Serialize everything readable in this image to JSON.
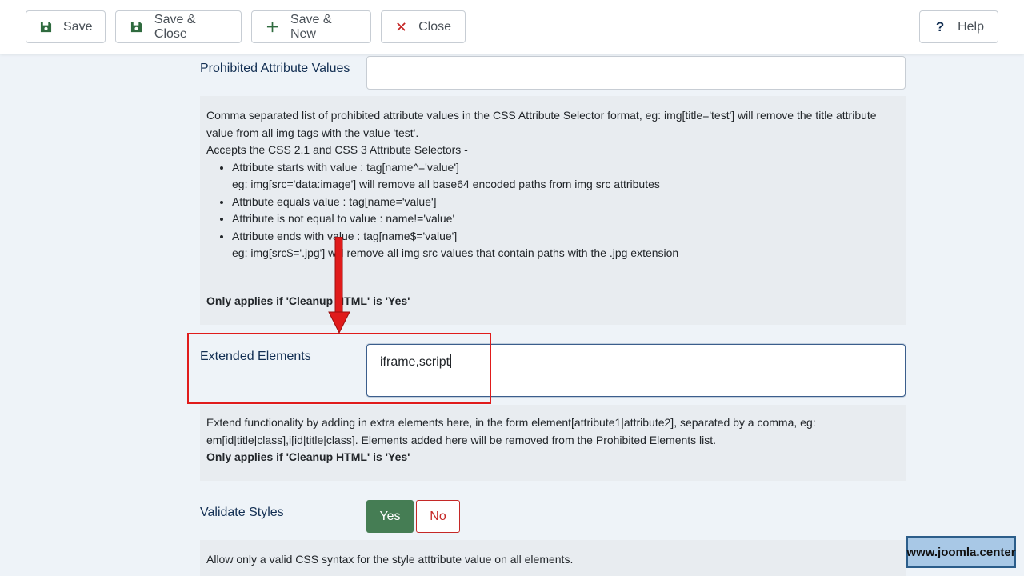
{
  "toolbar": {
    "save_label": "Save",
    "save_close_label": "Save & Close",
    "save_new_label": "Save & New",
    "close_label": "Close",
    "help_label": "Help"
  },
  "prohibited_attr": {
    "label": "Prohibited Attribute Values",
    "value": "",
    "desc_line1": "Comma separated list of prohibited attribute values in the CSS Attribute Selector format, eg: img[title='test'] will remove the title attribute value from all img tags with the value 'test'.",
    "desc_line2": "Accepts the CSS 2.1 and CSS 3 Attribute Selectors -",
    "items": [
      {
        "text": "Attribute starts with value : tag[name^='value']",
        "sub": "eg: img[src='data:image'] will remove all base64 encoded paths from img src attributes"
      },
      {
        "text": "Attribute equals value : tag[name='value']",
        "sub": ""
      },
      {
        "text": "Attribute is not equal to value : name!='value'",
        "sub": ""
      },
      {
        "text": "Attribute ends with value : tag[name$='value']",
        "sub": "eg: img[src$='.jpg'] will remove all img src values that contain paths with the .jpg extension"
      }
    ],
    "note": "Only applies if 'Cleanup HTML' is 'Yes'"
  },
  "extended_elements": {
    "label": "Extended Elements",
    "value": "iframe,script",
    "desc": "Extend functionality by adding in extra elements here, in the form element[attribute1|attribute2], separated by a comma, eg: em[id|title|class],i[id|title|class]. Elements added here will be removed from the Prohibited Elements list.",
    "note": "Only applies if 'Cleanup HTML' is 'Yes'"
  },
  "validate_styles": {
    "label": "Validate Styles",
    "yes_label": "Yes",
    "no_label": "No",
    "selected": "Yes",
    "desc": "Allow only a valid CSS syntax for the style atttribute value on all elements."
  },
  "watermark": {
    "text": "www.joomla.center"
  },
  "colors": {
    "accent_green": "#457d54",
    "danger_red": "#c52827",
    "highlight_red": "#e01b1b",
    "label_blue": "#132f53"
  }
}
